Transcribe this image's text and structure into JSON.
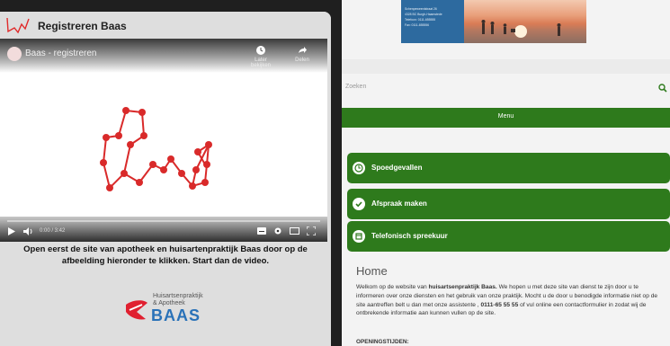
{
  "left": {
    "title": "Registreren Baas",
    "video": {
      "title": "Baas - registreren",
      "watch_later_label": "Later bekijken",
      "share_label": "Delen",
      "time": "0:00 / 3:42"
    },
    "instruction": "Open eerst de site van apotheek en huisartenpraktijk Baas door op de afbeelding hieronder te klikken. Start dan de video.",
    "baas_logo": {
      "line1": "Huisartsenpraktijk",
      "line2": "& Apotheek",
      "word": "BAAS"
    }
  },
  "right": {
    "contact": {
      "lines": [
        "Schenpeweerdstraat 26",
        "4328 BC  Burgh-Haamstede",
        "Telefoon: 0111-655555",
        "Fax: 0111-655556"
      ]
    },
    "search": {
      "placeholder": "Zoeken"
    },
    "menu_label": "Menu",
    "buttons": [
      {
        "label": "Spoedgevallen",
        "icon": "emergency-icon"
      },
      {
        "label": "Afspraak maken",
        "icon": "checkmark-icon"
      },
      {
        "label": "Telefonisch spreekuur",
        "icon": "calendar-icon"
      }
    ],
    "home": {
      "title": "Home",
      "text_part1": "Welkom op de website van ",
      "text_bold1": "huisartsenpraktijk Baas.",
      "text_part2": " We hopen u met deze site van dienst te zijn door u te informeren over onze diensten en het gebruik van onze praktijk. Mocht u de door u benodigde informatie niet op de site aantreffen belt u dan met onze assistente , ",
      "text_bold2": "0111-65 55 55",
      "text_part3": " of vul online een contactformulier in zodat wij de ontbrekende informatie aan kunnen vullen op de site.",
      "hours_label": "OPENINGSTIJDEN:"
    },
    "colors": {
      "green": "#2e7a1c",
      "blue": "#2d6a9f"
    }
  }
}
